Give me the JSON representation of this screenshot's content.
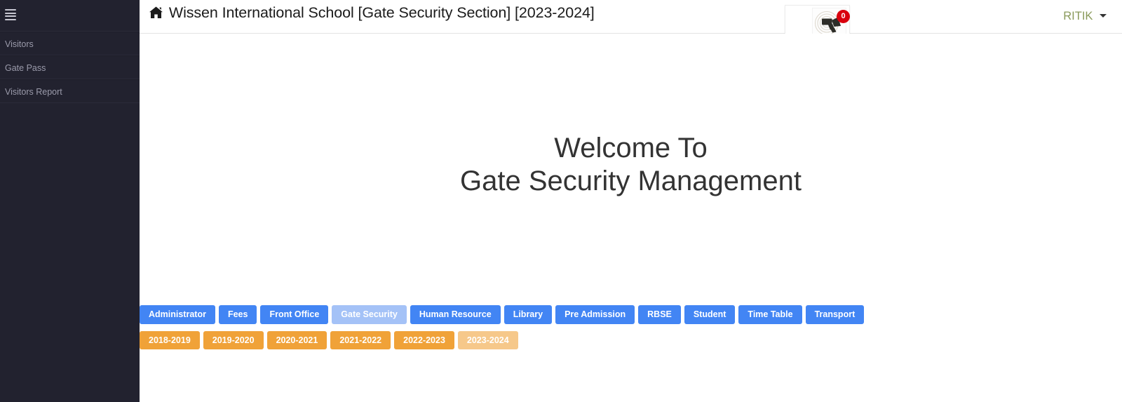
{
  "sidebar": {
    "menu_icon": "hamburger-icon",
    "items": [
      {
        "label": "Visitors"
      },
      {
        "label": "Gate Pass"
      },
      {
        "label": "Visitors Report"
      }
    ]
  },
  "header": {
    "home_icon": "home-icon",
    "title": "Wissen International School [Gate Security Section] [2023-2024]",
    "notification": {
      "icon": "announcement-megaphone-icon",
      "badge_count": "0",
      "badge_color": "#d9000d"
    },
    "user": {
      "name": "RITIK",
      "caret_icon": "chevron-down-icon",
      "color": "#8a9a5b"
    }
  },
  "main": {
    "welcome_line1": "Welcome To",
    "welcome_line2": "Gate Security Management"
  },
  "modules": {
    "accent_color": "#4285f4",
    "active_color": "#a4c2f7",
    "items": [
      {
        "label": "Administrator",
        "active": false
      },
      {
        "label": "Fees",
        "active": false
      },
      {
        "label": "Front Office",
        "active": false
      },
      {
        "label": "Gate Security",
        "active": true
      },
      {
        "label": "Human Resource",
        "active": false
      },
      {
        "label": "Library",
        "active": false
      },
      {
        "label": "Pre Admission",
        "active": false
      },
      {
        "label": "RBSE",
        "active": false
      },
      {
        "label": "Student",
        "active": false
      },
      {
        "label": "Time Table",
        "active": false
      },
      {
        "label": "Transport",
        "active": false
      }
    ]
  },
  "sessions": {
    "accent_color": "#f0a238",
    "active_color": "#f6c88a",
    "items": [
      {
        "label": "2018-2019",
        "active": false
      },
      {
        "label": "2019-2020",
        "active": false
      },
      {
        "label": "2020-2021",
        "active": false
      },
      {
        "label": "2021-2022",
        "active": false
      },
      {
        "label": "2022-2023",
        "active": false
      },
      {
        "label": "2023-2024",
        "active": true
      }
    ]
  }
}
